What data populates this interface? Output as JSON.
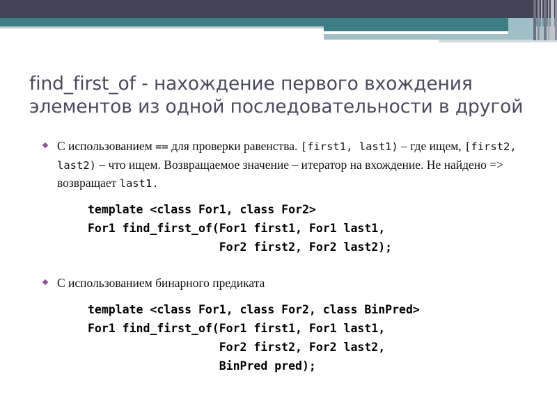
{
  "slide": {
    "title_line1": "find_first_of - нахождение первого вхождения",
    "title_line2": "элементов из одной последовательности в другой",
    "title_color": "#4a4a5e",
    "bullet_color": "#8e4f97"
  },
  "banner": {
    "navy": "#434355",
    "teal": "#3d7e84",
    "pale": "#b9ced3",
    "mid": "#a2c0c6",
    "tail": "#cfdee1"
  },
  "bullets": [
    {
      "id": "bullet-1",
      "runs": [
        {
          "type": "text",
          "value": "С использованием "
        },
        {
          "type": "code",
          "value": "=="
        },
        {
          "type": "text",
          "value": " для проверки равенства. "
        },
        {
          "type": "code",
          "value": "[first1, last1)"
        },
        {
          "type": "text",
          "value": " – где ищем, "
        },
        {
          "type": "code",
          "value": "[first2, last2)"
        },
        {
          "type": "text",
          "value": " – что ищем. Возвращаемое значение – итератор на вхождение. Не найдено => возвращает "
        },
        {
          "type": "code",
          "value": "last1."
        }
      ],
      "plain": "С использованием == для проверки равенства. [first1, last1) – где ищем, [first2, last2) – что ищем. Возвращаемое значение – итератор на вхождение. Не найдено => возвращает last1."
    },
    {
      "id": "bullet-2",
      "runs": [
        {
          "type": "text",
          "value": "С использованием бинарного предиката"
        }
      ],
      "plain": "С использованием бинарного предиката"
    }
  ],
  "code_blocks": [
    {
      "id": "code-block-1",
      "lines": [
        "template <class For1, class For2>",
        "For1 find_first_of(For1 first1, For1 last1,",
        "                   For2 first2, For2 last2);"
      ],
      "text": "template <class For1, class For2>\nFor1 find_first_of(For1 first1, For1 last1,\n                   For2 first2, For2 last2);"
    },
    {
      "id": "code-block-2",
      "lines": [
        "template <class For1, class For2, class BinPred>",
        "For1 find_first_of(For1 first1, For1 last1,",
        "                   For2 first2, For2 last2,",
        "                   BinPred pred);"
      ],
      "text": "template <class For1, class For2, class BinPred>\nFor1 find_first_of(For1 first1, For1 last1,\n                   For2 first2, For2 last2,\n                   BinPred pred);"
    }
  ]
}
